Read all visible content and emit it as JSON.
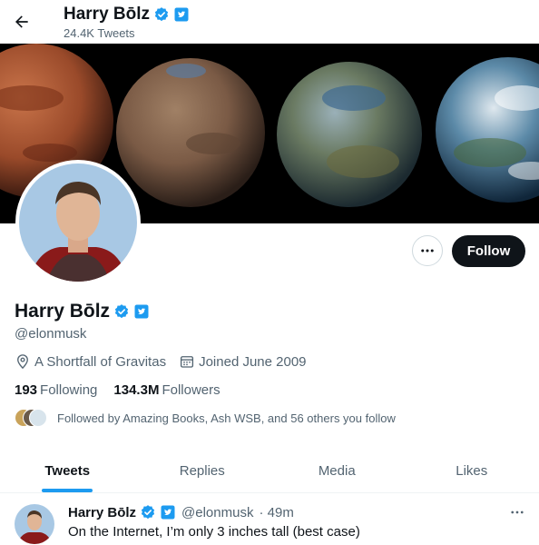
{
  "header": {
    "name": "Harry Bōlz",
    "tweet_count": "24.4K Tweets"
  },
  "profile": {
    "name": "Harry Bōlz",
    "handle": "@elonmusk",
    "location": "A Shortfall of Gravitas",
    "joined": "Joined June 2009",
    "following_count": "193",
    "following_label": "Following",
    "followers_count": "134.3M",
    "followers_label": "Followers",
    "followed_by": "Followed by Amazing Books, Ash WSB, and 56 others you follow"
  },
  "actions": {
    "follow_label": "Follow"
  },
  "tabs": [
    {
      "label": "Tweets",
      "active": true
    },
    {
      "label": "Replies",
      "active": false
    },
    {
      "label": "Media",
      "active": false
    },
    {
      "label": "Likes",
      "active": false
    }
  ],
  "tweet": {
    "name": "Harry Bōlz",
    "handle": "@elonmusk",
    "time": "· 49m",
    "text": "On the Internet, I’m only 3 inches tall (best case)"
  },
  "colors": {
    "accent": "#1d9bf0",
    "follow_button": "#0f1419",
    "secondary_text": "#536471"
  },
  "icons": [
    "back-arrow-icon",
    "verified-badge-icon",
    "twitter-blue-icon",
    "location-icon",
    "calendar-icon",
    "more-icon"
  ]
}
